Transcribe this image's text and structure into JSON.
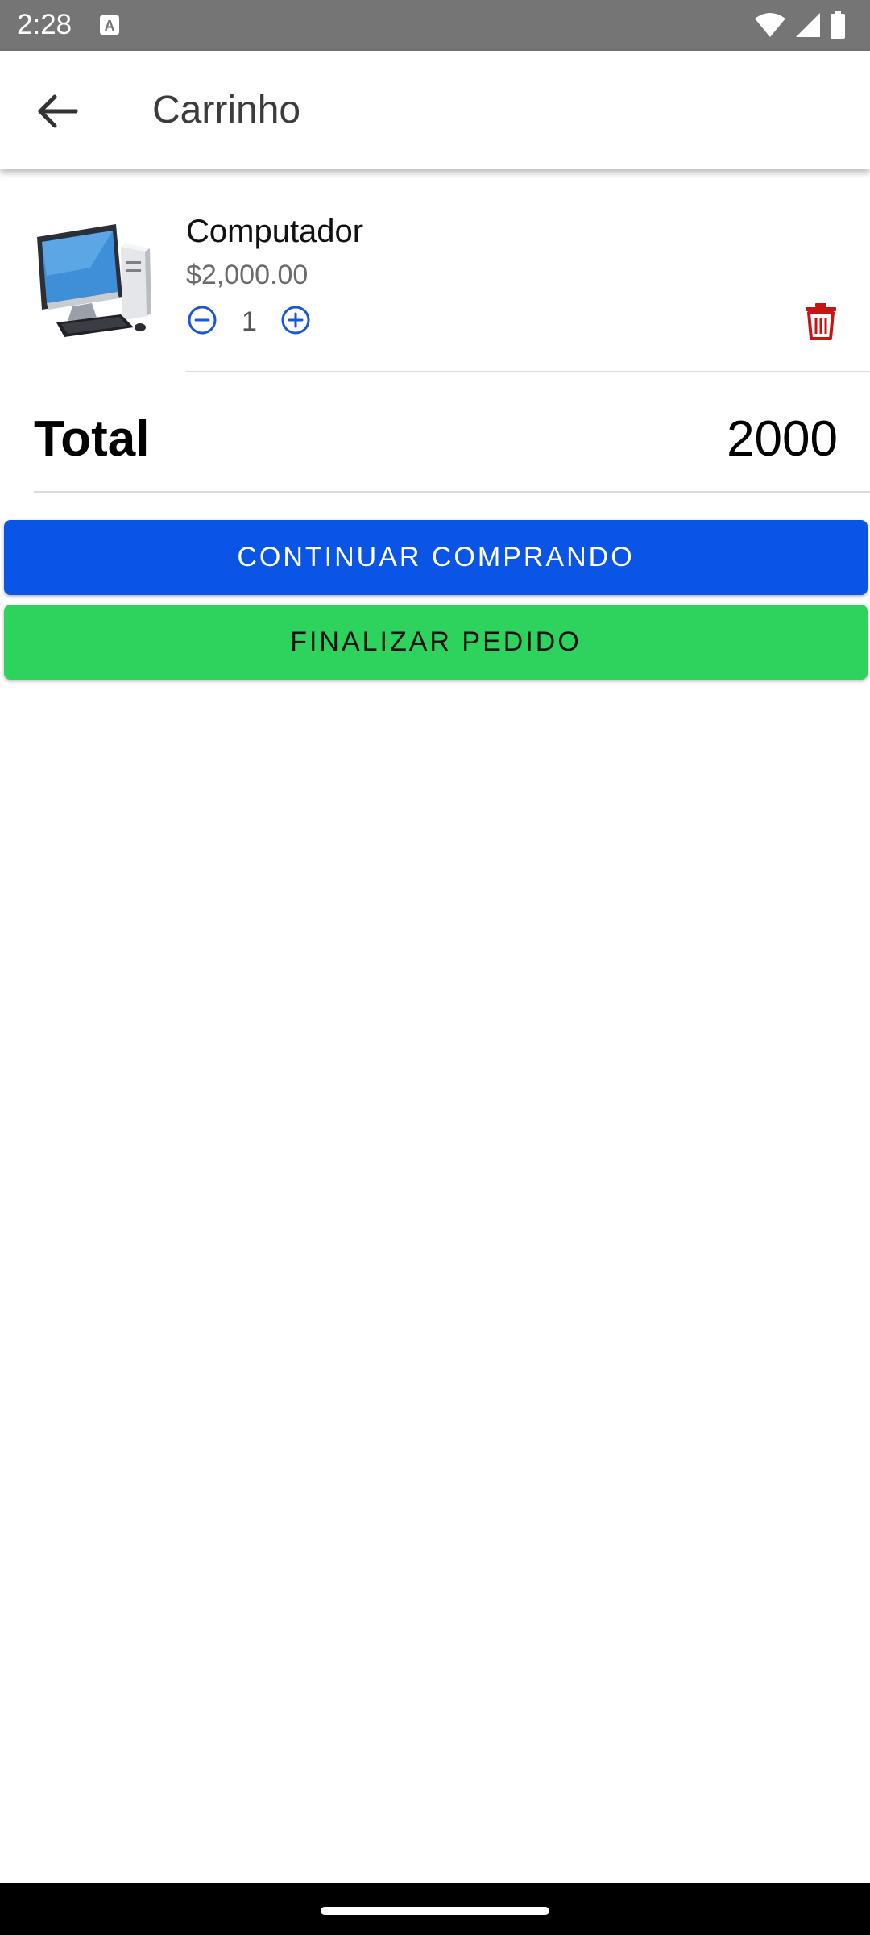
{
  "status_bar": {
    "time": "2:28",
    "icons": [
      "a-notification-icon",
      "wifi-icon",
      "cellular-signal-icon",
      "battery-icon"
    ]
  },
  "app_bar": {
    "title": "Carrinho",
    "back_icon": "arrow-back-icon"
  },
  "cart": {
    "items": [
      {
        "name": "Computador",
        "price": "$2,000.00",
        "quantity": "1",
        "image": "computer-product-image"
      }
    ]
  },
  "summary": {
    "total_label": "Total",
    "total_value": "2000"
  },
  "actions": {
    "continue_label": "CONTINUAR COMPRANDO",
    "finish_label": "FINALIZAR PEDIDO"
  },
  "colors": {
    "status_bar": "#757575",
    "primary_blue": "#0a54e6",
    "success_green": "#2ed35d",
    "delete_red": "#c51616",
    "qty_icon_blue": "#1a56d6"
  }
}
